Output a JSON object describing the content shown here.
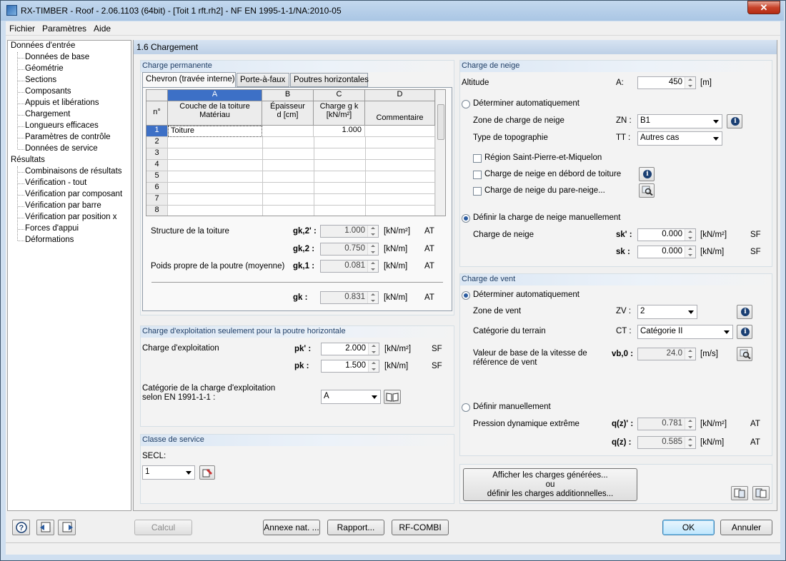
{
  "window": {
    "title": "RX-TIMBER - Roof - 2.06.1103 (64bit) - [Toit 1 rft.rh2] - NF EN 1995-1-1/NA:2010-05",
    "close": "✕"
  },
  "menu": [
    "Fichier",
    "Paramètres",
    "Aide"
  ],
  "nav": {
    "root1": "Données d'entrée",
    "inputs": [
      "Données de base",
      "Géométrie",
      "Sections",
      "Composants",
      "Appuis et libérations",
      "Chargement",
      "Longueurs efficaces",
      "Paramètres de contrôle",
      "Données de service"
    ],
    "root2": "Résultats",
    "results": [
      "Combinaisons de résultats",
      "Vérification - tout",
      "Vérification par composant",
      "Vérification par barre",
      "Vérification par position x",
      "Forces d'appui",
      "Déformations"
    ]
  },
  "section_title": "1.6 Chargement",
  "perm": {
    "title": "Charge permanente",
    "tabs": [
      "Chevron (travée interne)",
      "Porte-à-faux",
      "Poutres horizontales"
    ],
    "grid": {
      "col_letters": [
        "A",
        "B",
        "C",
        "D"
      ],
      "row_header": "n°",
      "col_a": [
        "Couche de la toiture",
        "Matériau"
      ],
      "col_b": [
        "Épaisseur",
        "d [cm]"
      ],
      "col_c": [
        "Charge g k",
        "[kN/m²]"
      ],
      "col_d": "Commentaire",
      "rows": [
        "1",
        "2",
        "3",
        "4",
        "5",
        "6",
        "7",
        "8"
      ],
      "row1_material": "Toiture",
      "row1_load": "1.000"
    },
    "structure_label": "Structure de la toiture",
    "poids_label": "Poids propre de la poutre (moyenne)",
    "gk2p": {
      "sym": "gk,2' :",
      "val": "1.000",
      "unit": "[kN/m²]",
      "tag": "AT"
    },
    "gk2": {
      "sym": "gk,2 :",
      "val": "0.750",
      "unit": "[kN/m]",
      "tag": "AT"
    },
    "gk1": {
      "sym": "gk,1 :",
      "val": "0.081",
      "unit": "[kN/m]",
      "tag": "AT"
    },
    "gk": {
      "sym": "gk :",
      "val": "0.831",
      "unit": "[kN/m]",
      "tag": "AT"
    }
  },
  "expl": {
    "title": "Charge d'exploitation seulement pour la poutre horizontale",
    "label": "Charge d'exploitation",
    "pkp": {
      "sym": "pk' :",
      "val": "2.000",
      "unit": "[kN/m²]",
      "tag": "SF"
    },
    "pk": {
      "sym": "pk :",
      "val": "1.500",
      "unit": "[kN/m]",
      "tag": "SF"
    },
    "cat_label1": "Catégorie de la charge d'exploitation",
    "cat_label2": "selon EN 1991-1-1 :",
    "cat_value": "A"
  },
  "service": {
    "title": "Classe de service",
    "secl_label": "SECL:",
    "secl_value": "1"
  },
  "snow": {
    "title": "Charge de neige",
    "altitude_label": "Altitude",
    "altitude_sym": "A:",
    "altitude_val": "450",
    "altitude_unit": "[m]",
    "auto_label": "Déterminer automatiquement",
    "zone_label": "Zone de charge de neige",
    "zone_sym": "ZN :",
    "zone_val": "B1",
    "topo_label": "Type de topographie",
    "topo_sym": "TT :",
    "topo_val": "Autres cas",
    "chk1": "Région Saint-Pierre-et-Miquelon",
    "chk2": "Charge de neige en débord de toiture",
    "chk3": "Charge de neige du pare-neige...",
    "manual_label": "Définir la charge de neige manuellement",
    "snow_label": "Charge de neige",
    "skp": {
      "sym": "sk' :",
      "val": "0.000",
      "unit": "[kN/m²]",
      "tag": "SF"
    },
    "sk": {
      "sym": "sk :",
      "val": "0.000",
      "unit": "[kN/m]",
      "tag": "SF"
    }
  },
  "wind": {
    "title": "Charge de vent",
    "auto_label": "Déterminer automatiquement",
    "zone_label": "Zone de vent",
    "zone_sym": "ZV :",
    "zone_val": "2",
    "cat_label": "Catégorie du terrain",
    "cat_sym": "CT :",
    "cat_val": "Catégorie II",
    "vb_label1": "Valeur de base de la vitesse de",
    "vb_label2": "référence de vent",
    "vb_sym": "vb,0 :",
    "vb_val": "24.0",
    "vb_unit": "[m/s]",
    "manual_label": "Définir manuellement",
    "press_label": "Pression dynamique extrême",
    "qzp": {
      "sym": "q(z)' :",
      "val": "0.781",
      "unit": "[kN/m²]",
      "tag": "AT"
    },
    "qz": {
      "sym": "q(z) :",
      "val": "0.585",
      "unit": "[kN/m]",
      "tag": "AT"
    }
  },
  "show_loads": [
    "Afficher les charges générées...",
    "ou",
    "définir les charges additionnelles..."
  ],
  "bottom": {
    "calc": "Calcul",
    "annexe": "Annexe nat. ...",
    "rapport": "Rapport...",
    "rfcombi": "RF-COMBI",
    "ok": "OK",
    "cancel": "Annuler"
  },
  "colors": {
    "accent": "#3d70c6",
    "group_head": "#1f3e66"
  }
}
